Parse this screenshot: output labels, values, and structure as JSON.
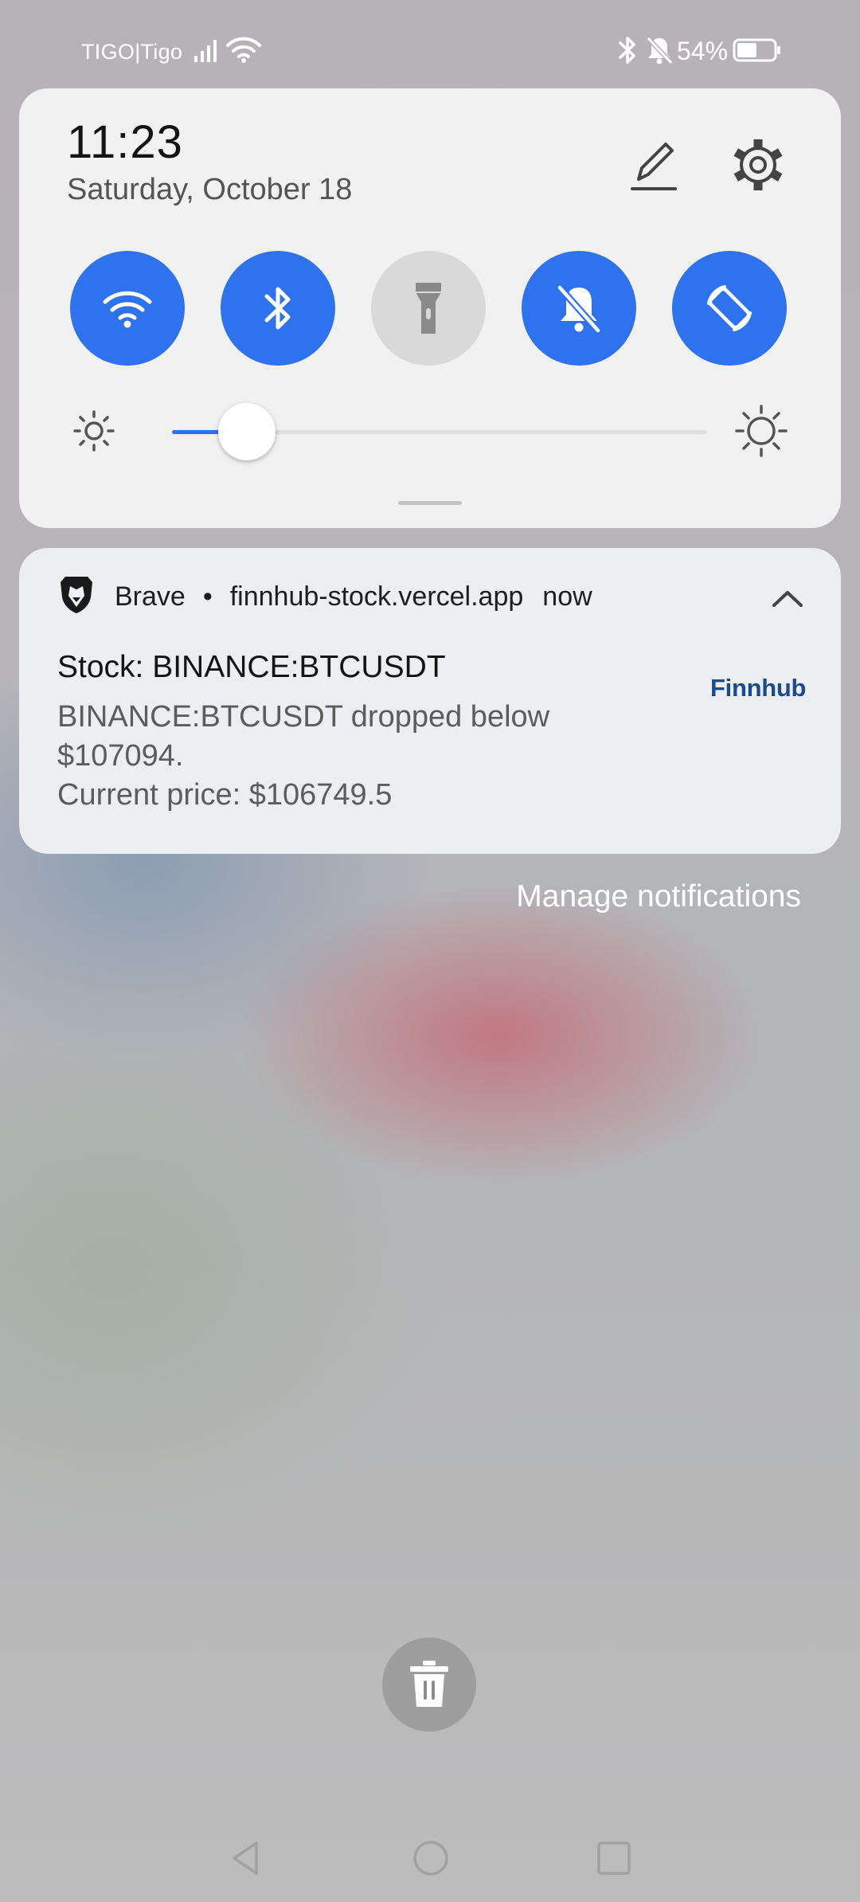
{
  "status_bar": {
    "carrier": "TIGO|Tigo",
    "battery_percent": "54%",
    "battery_level": 0.54,
    "icons": [
      "signal-icon",
      "wifi-icon",
      "bluetooth-icon",
      "mute-icon",
      "battery-icon"
    ]
  },
  "quick_settings": {
    "time": "11:23",
    "date": "Saturday, October 18",
    "accent_color": "#2e72f0",
    "tiles": [
      {
        "name": "wifi",
        "icon": "wifi-icon",
        "active": true
      },
      {
        "name": "bluetooth",
        "icon": "bluetooth-icon",
        "active": true
      },
      {
        "name": "flashlight",
        "icon": "flashlight-icon",
        "active": false
      },
      {
        "name": "silent",
        "icon": "bell-off-icon",
        "active": true
      },
      {
        "name": "auto-rotate",
        "icon": "rotate-icon",
        "active": true
      }
    ],
    "brightness_level": 0.14
  },
  "notification": {
    "app_name": "Brave",
    "separator": "•",
    "source": "finnhub-stock.vercel.app",
    "time": "now",
    "title": "Stock: BINANCE:BTCUSDT",
    "body_lines": [
      "BINANCE:BTCUSDT dropped below",
      "$107094.",
      "Current price: $106749.5"
    ],
    "brand_logo": "Finnhub",
    "brand_color": "#1b4b8f"
  },
  "manage_notifications_label": "Manage notifications",
  "nav_bar": {
    "icons": [
      "back-icon",
      "home-icon",
      "recents-icon"
    ]
  }
}
